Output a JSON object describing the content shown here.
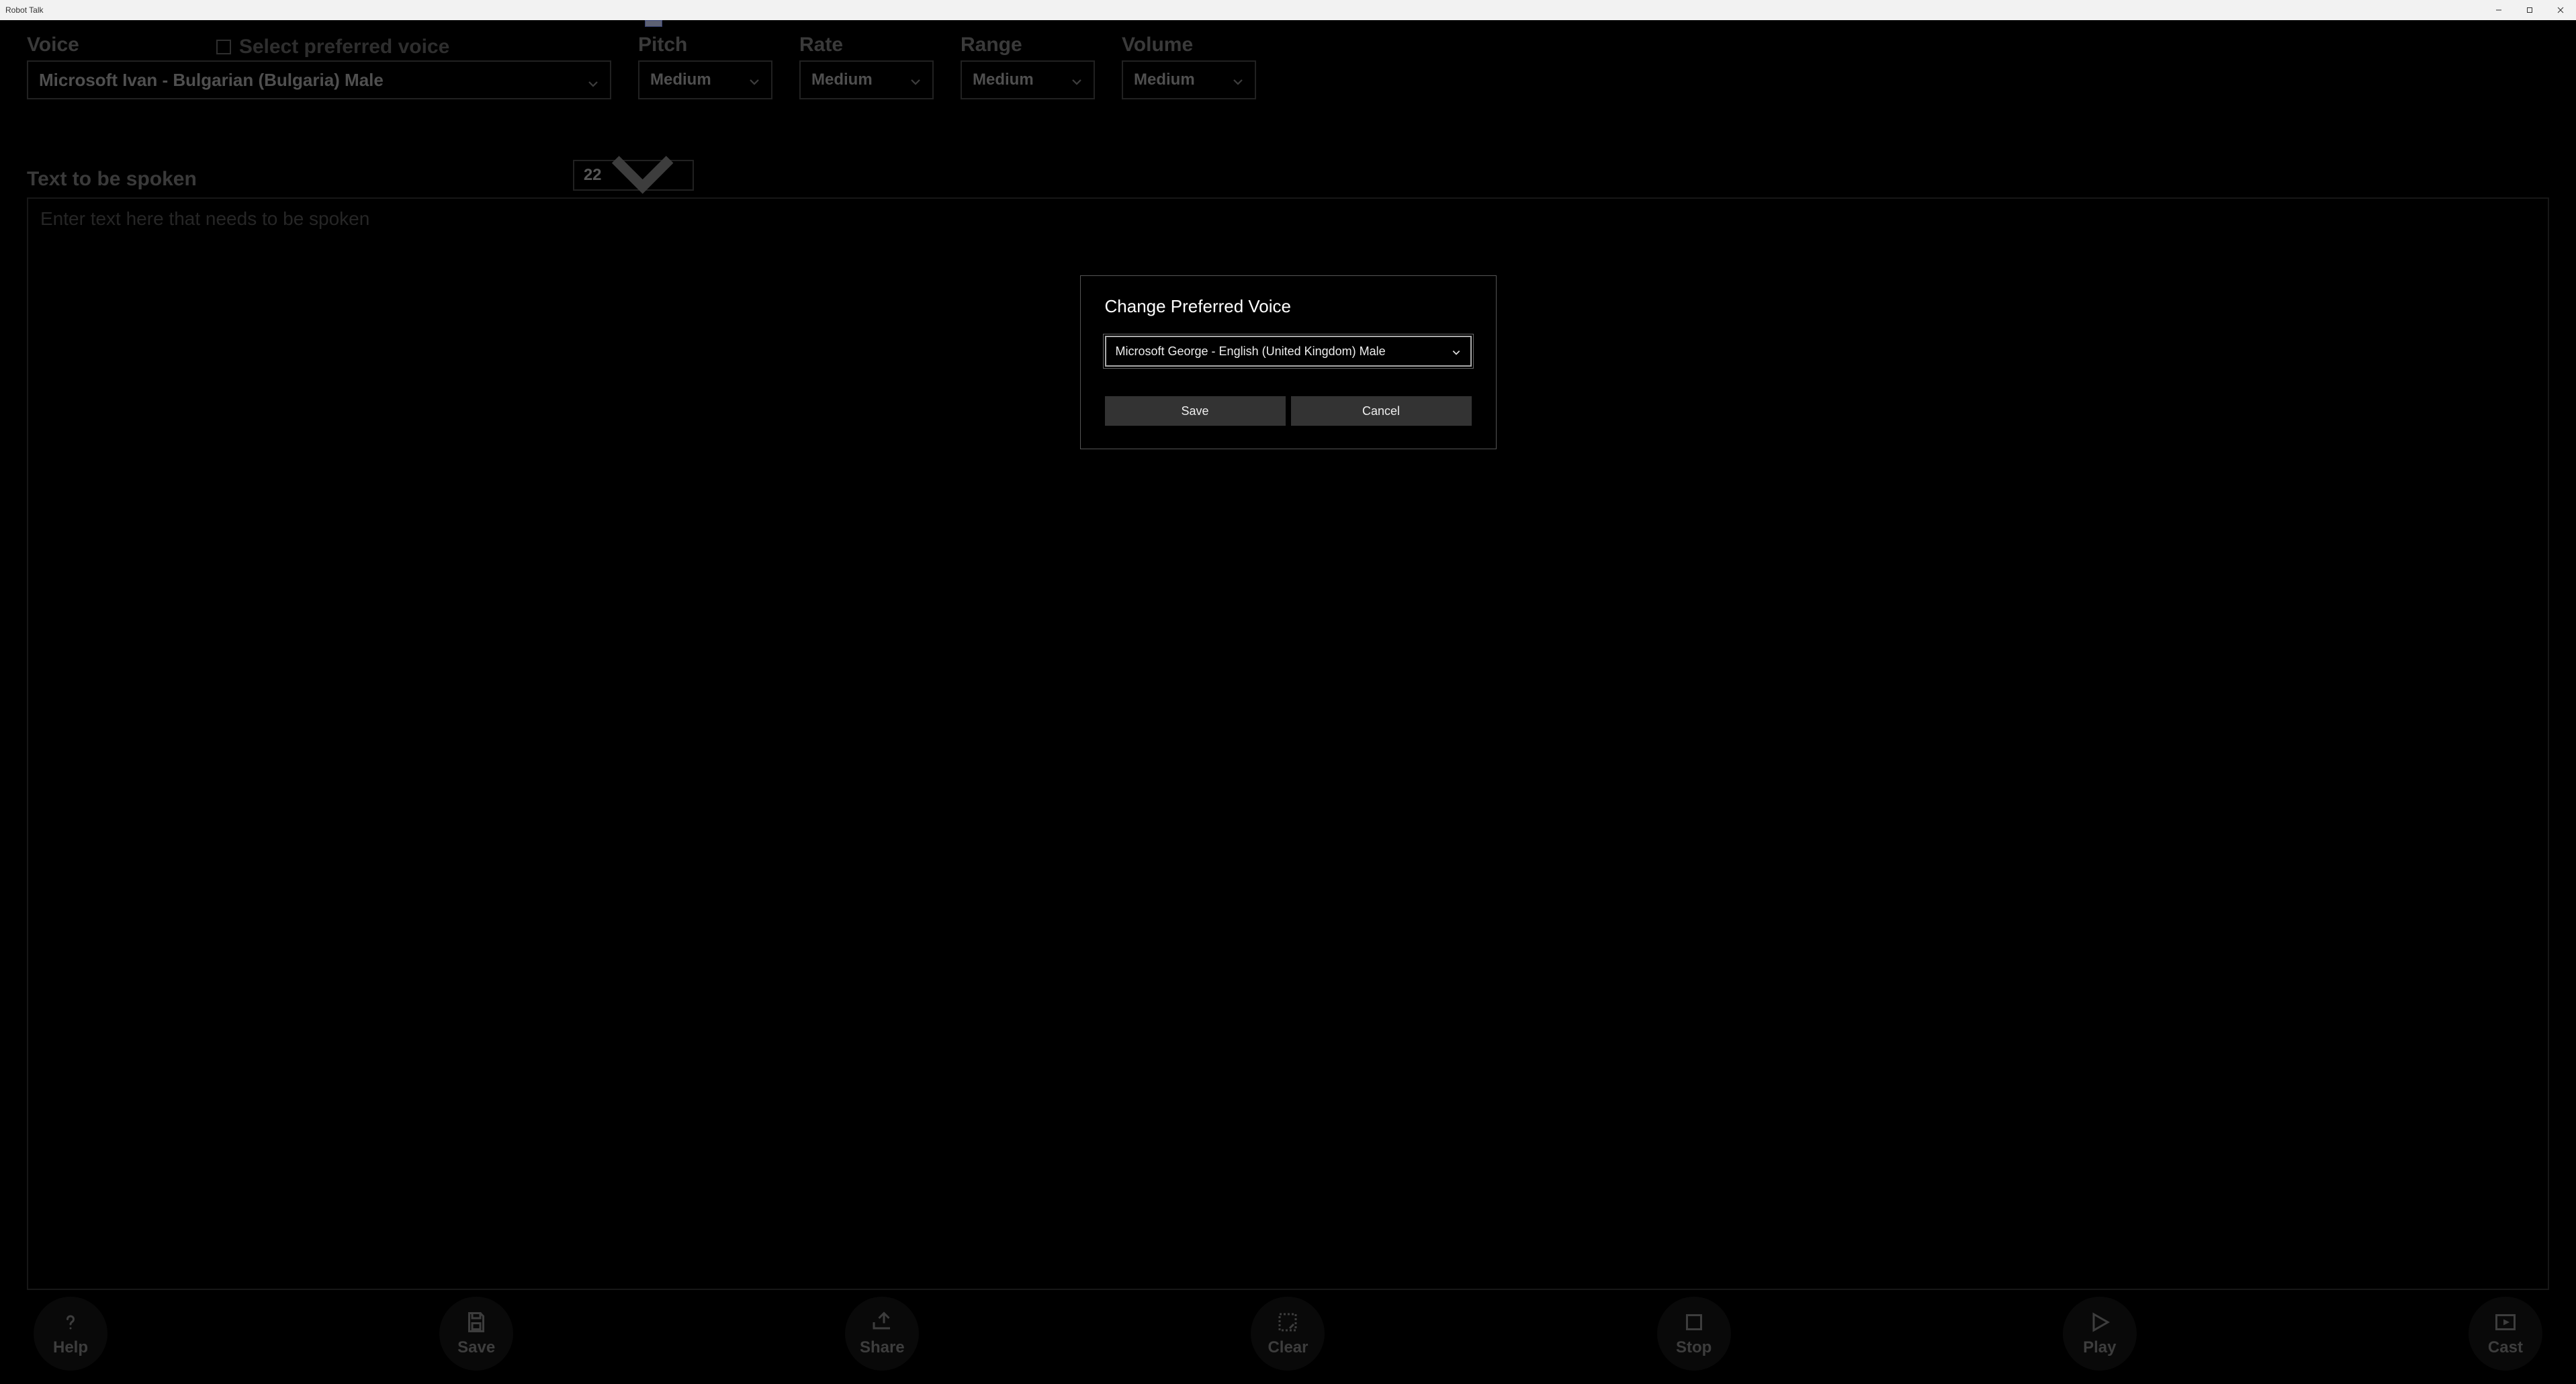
{
  "window": {
    "title": "Robot Talk"
  },
  "top": {
    "voice_label": "Voice",
    "select_preferred_label": "Select preferred voice",
    "voice_value": "Microsoft Ivan - Bulgarian (Bulgaria) Male",
    "pitch_label": "Pitch",
    "pitch_value": "Medium",
    "rate_label": "Rate",
    "rate_value": "Medium",
    "range_label": "Range",
    "range_value": "Medium",
    "volume_label": "Volume",
    "volume_value": "Medium"
  },
  "text_area": {
    "label": "Text to be spoken",
    "placeholder": "Enter text here that needs to be spoken",
    "font_size_value": "22"
  },
  "bottom": {
    "help": "Help",
    "save": "Save",
    "share": "Share",
    "clear": "Clear",
    "stop": "Stop",
    "play": "Play",
    "cast": "Cast"
  },
  "modal": {
    "title": "Change Preferred Voice",
    "voice_value": "Microsoft George - English (United Kingdom) Male",
    "save_label": "Save",
    "cancel_label": "Cancel"
  }
}
